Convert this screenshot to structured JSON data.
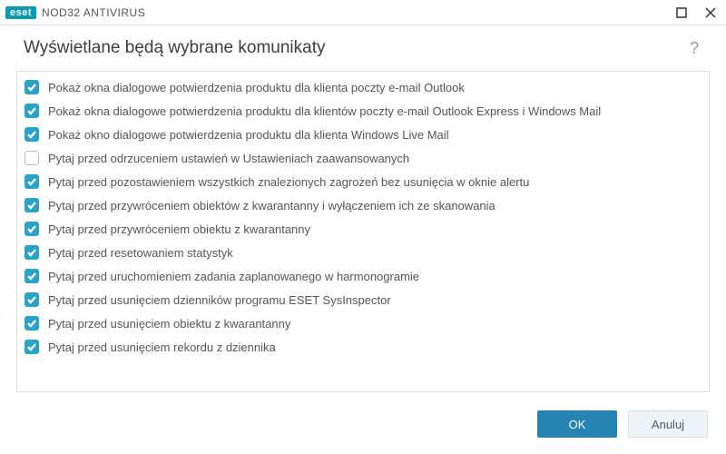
{
  "brand": {
    "badge": "eset",
    "product": "NOD32 ANTIVIRUS"
  },
  "header": {
    "title": "Wyświetlane będą wybrane komunikaty"
  },
  "help_char": "?",
  "items": [
    {
      "checked": true,
      "label": "Pokaż okna dialogowe potwierdzenia produktu dla klienta poczty e-mail Outlook"
    },
    {
      "checked": true,
      "label": "Pokaż okna dialogowe potwierdzenia produktu dla klientów poczty e-mail Outlook Express i Windows Mail"
    },
    {
      "checked": true,
      "label": "Pokaż okno dialogowe potwierdzenia produktu dla klienta Windows Live Mail"
    },
    {
      "checked": false,
      "label": "Pytaj przed odrzuceniem ustawień w Ustawieniach zaawansowanych"
    },
    {
      "checked": true,
      "label": "Pytaj przed pozostawieniem wszystkich znalezionych zagrożeń bez usunięcia w oknie alertu"
    },
    {
      "checked": true,
      "label": "Pytaj przed przywróceniem obiektów z kwarantanny i wyłączeniem ich ze skanowania"
    },
    {
      "checked": true,
      "label": "Pytaj przed przywróceniem obiektu z kwarantanny"
    },
    {
      "checked": true,
      "label": "Pytaj przed resetowaniem statystyk"
    },
    {
      "checked": true,
      "label": "Pytaj przed uruchomieniem zadania zaplanowanego w harmonogramie"
    },
    {
      "checked": true,
      "label": "Pytaj przed usunięciem dzienników programu ESET SysInspector"
    },
    {
      "checked": true,
      "label": "Pytaj przed usunięciem obiektu z kwarantanny"
    },
    {
      "checked": true,
      "label": "Pytaj przed usunięciem rekordu z dziennika"
    }
  ],
  "footer": {
    "ok": "OK",
    "cancel": "Anuluj"
  }
}
